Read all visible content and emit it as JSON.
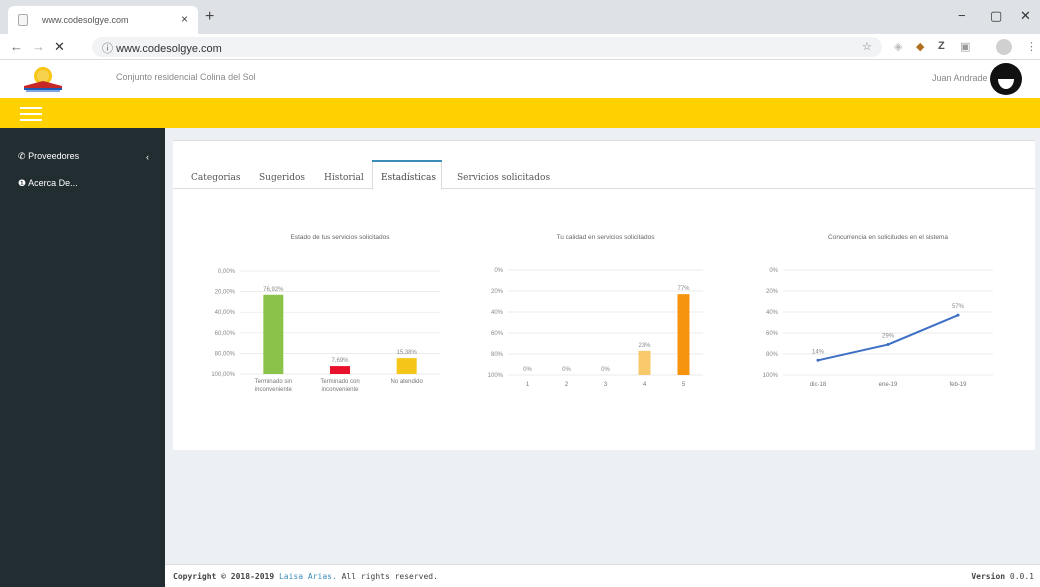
{
  "browser": {
    "tab_title": "www.codesolgye.com",
    "tab_close": "×",
    "new_tab": "+",
    "url": "www.codesolgye.com",
    "win_min": "−",
    "win_max": "▢",
    "win_close": "✕"
  },
  "app": {
    "org_name": "Conjunto residencial Colina del Sol",
    "user_name": "Juan Andrade"
  },
  "sidebar": {
    "items": [
      {
        "label": "Proveedores"
      },
      {
        "label": "Acerca De..."
      }
    ]
  },
  "tabs": [
    {
      "label": "Categorias"
    },
    {
      "label": "Sugeridos"
    },
    {
      "label": "Historial"
    },
    {
      "label": "Estadísticas"
    },
    {
      "label": "Servicios solicitados"
    }
  ],
  "charts": {
    "chart1": {
      "title": "Estado de tus servicios solicitados",
      "ticks": [
        "100,00%",
        "80,00%",
        "60,00%",
        "40,00%",
        "20,00%",
        "0,00%"
      ],
      "bars": [
        {
          "value": 76.92,
          "label": "76,92%",
          "color": "#8bc34a",
          "cat1": "Terminado sin",
          "cat2": "inconveniente"
        },
        {
          "value": 7.69,
          "label": "7,69%",
          "color": "#e8102a",
          "cat1": "Terminado con",
          "cat2": "inconveniente"
        },
        {
          "value": 15.38,
          "label": "15,38%",
          "color": "#f5c518",
          "cat1": "No atendido",
          "cat2": ""
        }
      ]
    },
    "chart2": {
      "title": "Tu calidad en servicios solicitados",
      "ticks": [
        "100%",
        "80%",
        "60%",
        "40%",
        "20%",
        "0%"
      ],
      "bars": [
        {
          "value": 0,
          "label": "0%",
          "color": "#f7c96b",
          "cat": "1"
        },
        {
          "value": 0,
          "label": "0%",
          "color": "#f7c96b",
          "cat": "2"
        },
        {
          "value": 0,
          "label": "0%",
          "color": "#f7c96b",
          "cat": "3"
        },
        {
          "value": 23,
          "label": "23%",
          "color": "#f7c96b",
          "cat": "4"
        },
        {
          "value": 77,
          "label": "77%",
          "color": "#f7940f",
          "cat": "5"
        }
      ]
    },
    "chart3": {
      "title": "Concurrencia en solicitudes en el sistema",
      "ticks": [
        "100%",
        "80%",
        "60%",
        "40%",
        "20%",
        "0%"
      ],
      "points": [
        {
          "value": 14,
          "label": "14%",
          "cat": "dic-18"
        },
        {
          "value": 29,
          "label": "29%",
          "cat": "ene-19"
        },
        {
          "value": 57,
          "label": "57%",
          "cat": "feb-19"
        }
      ],
      "color": "#3d6fc4"
    }
  },
  "chart_data": [
    {
      "type": "bar",
      "title": "Estado de tus servicios solicitados",
      "categories": [
        "Terminado sin inconveniente",
        "Terminado con inconveniente",
        "No atendido"
      ],
      "values": [
        76.92,
        7.69,
        15.38
      ],
      "ylim": [
        0,
        100
      ]
    },
    {
      "type": "bar",
      "title": "Tu calidad en servicios solicitados",
      "categories": [
        "1",
        "2",
        "3",
        "4",
        "5"
      ],
      "values": [
        0,
        0,
        0,
        23,
        77
      ],
      "ylim": [
        0,
        100
      ]
    },
    {
      "type": "line",
      "title": "Concurrencia en solicitudes en el sistema",
      "categories": [
        "dic-18",
        "ene-19",
        "feb-19"
      ],
      "values": [
        14,
        29,
        57
      ],
      "ylim": [
        0,
        100
      ]
    }
  ],
  "footer": {
    "copyright_prefix": "Copyright © 2018-2019",
    "author": "Laisa Arias.",
    "rights": "All rights reserved.",
    "version_label": "Version",
    "version_number": "0.0.1"
  }
}
